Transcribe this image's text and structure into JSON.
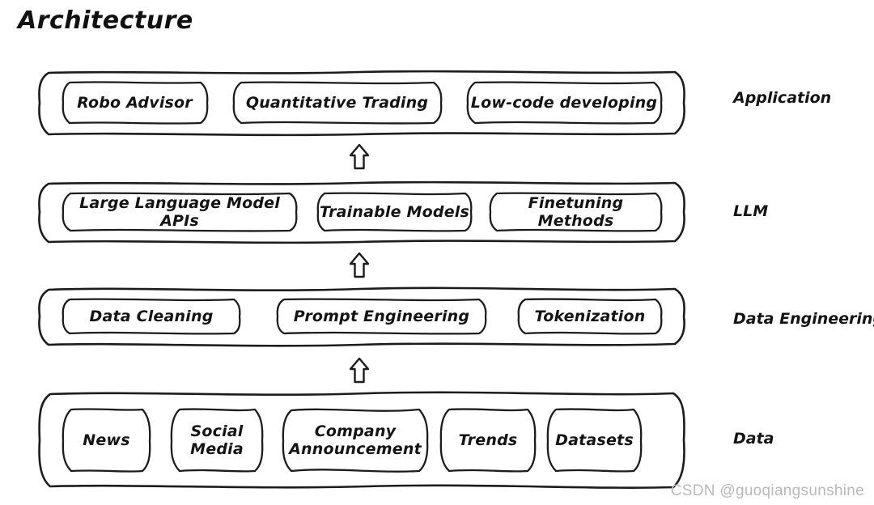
{
  "title": "Architecture",
  "watermark": "CSDN @guoqiangsunshine",
  "colors": {
    "background": "#ffffff",
    "stroke": "#1c1c1c",
    "text": "#141414",
    "watermark": "#b9b9b9"
  },
  "arrow_icon": "up-arrow-outline",
  "layers": [
    {
      "id": "application",
      "row_label": "Application",
      "items": [
        {
          "label": "Robo Advisor"
        },
        {
          "label": "Quantitative Trading"
        },
        {
          "label": "Low-code developing"
        }
      ]
    },
    {
      "id": "llm",
      "row_label": "LLM",
      "items": [
        {
          "label": "Large Language Model APIs"
        },
        {
          "label": "Trainable Models"
        },
        {
          "label": "Finetuning Methods"
        }
      ]
    },
    {
      "id": "data-engineering",
      "row_label": "Data Engineering",
      "items": [
        {
          "label": "Data Cleaning"
        },
        {
          "label": "Prompt Engineering"
        },
        {
          "label": "Tokenization"
        }
      ]
    },
    {
      "id": "data",
      "row_label": "Data",
      "items": [
        {
          "label": "News"
        },
        {
          "label": "Social\nMedia"
        },
        {
          "label": "Company\nAnnouncement"
        },
        {
          "label": "Trends"
        },
        {
          "label": "Datasets"
        }
      ]
    }
  ],
  "arrows": [
    {
      "from": "data-engineering",
      "to": "llm"
    },
    {
      "from": "llm",
      "to": "application"
    },
    {
      "from": "data",
      "to": "data-engineering"
    }
  ]
}
